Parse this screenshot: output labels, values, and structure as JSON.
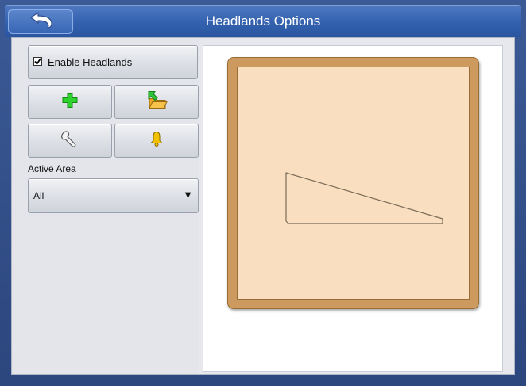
{
  "window": {
    "title": "Headlands Options"
  },
  "controls": {
    "enable_headlands_label": "Enable Headlands",
    "enable_headlands_checked": true,
    "active_area_label": "Active Area",
    "active_area_value": "All"
  },
  "icons": {
    "back": "back-arrow-icon",
    "add": "green-plus-icon",
    "load": "folder-load-icon",
    "edit": "wrench-icon",
    "alarm": "bell-icon",
    "dropdown": "triangle-down-icon"
  },
  "colors": {
    "title_bar": "#3563b0",
    "field_border": "#cc9a5e",
    "field_fill": "#f9dfbf",
    "add_icon": "#22cc22",
    "alarm_icon": "#f2c200"
  }
}
